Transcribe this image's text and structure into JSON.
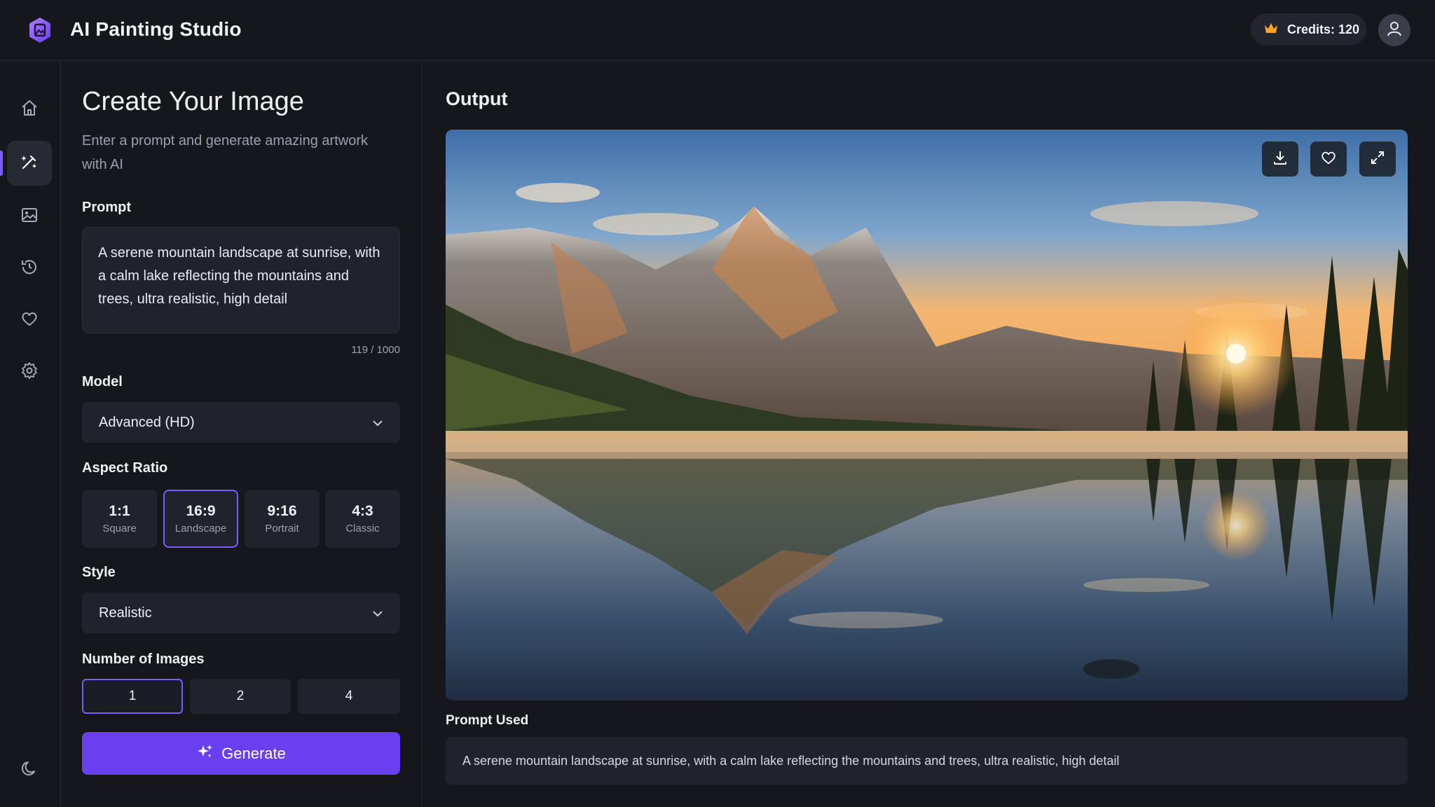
{
  "header": {
    "app_title": "AI Painting Studio",
    "credits_label": "Credits: 120",
    "credits_icon": "crown-icon",
    "avatar_icon": "user-icon"
  },
  "rail": {
    "items": [
      {
        "icon": "home-icon"
      },
      {
        "icon": "edit-wand-icon",
        "active": true
      },
      {
        "icon": "image-icon"
      },
      {
        "icon": "history-icon"
      },
      {
        "icon": "heart-icon"
      },
      {
        "icon": "settings-icon"
      }
    ],
    "bottom_icon": "moon-icon"
  },
  "create": {
    "title": "Create Your Image",
    "subtitle": "Enter a prompt and generate amazing artwork with AI",
    "prompt_label": "Prompt",
    "prompt_value": "A serene mountain landscape at sunrise, with a calm lake reflecting the mountains and trees, ultra realistic, high detail",
    "prompt_counter": "119 / 1000",
    "model_label": "Model",
    "model_value": "Advanced (HD)",
    "aspect_label": "Aspect Ratio",
    "aspect_options": [
      {
        "value": "1:1",
        "name": "Square"
      },
      {
        "value": "16:9",
        "name": "Landscape"
      },
      {
        "value": "9:16",
        "name": "Portrait"
      },
      {
        "value": "4:3",
        "name": "Classic"
      }
    ],
    "aspect_selected": "16:9",
    "style_label": "Style",
    "style_value": "Realistic",
    "count_label": "Number of Images",
    "count_options": [
      "1",
      "2",
      "4"
    ],
    "count_selected": "1",
    "generate_label": "Generate"
  },
  "output": {
    "title": "Output",
    "actions": [
      "download-icon",
      "heart-icon",
      "expand-icon"
    ],
    "prompt_used_label": "Prompt Used",
    "prompt_used_value": "A serene mountain landscape at sunrise, with a calm lake reflecting the mountains and trees, ultra realistic, high detail"
  },
  "colors": {
    "background": "#15171c",
    "surface": "#20232b",
    "accent": "#6a3ff0",
    "accent_border": "#7c5cff",
    "credits_crown": "#f5a623"
  }
}
